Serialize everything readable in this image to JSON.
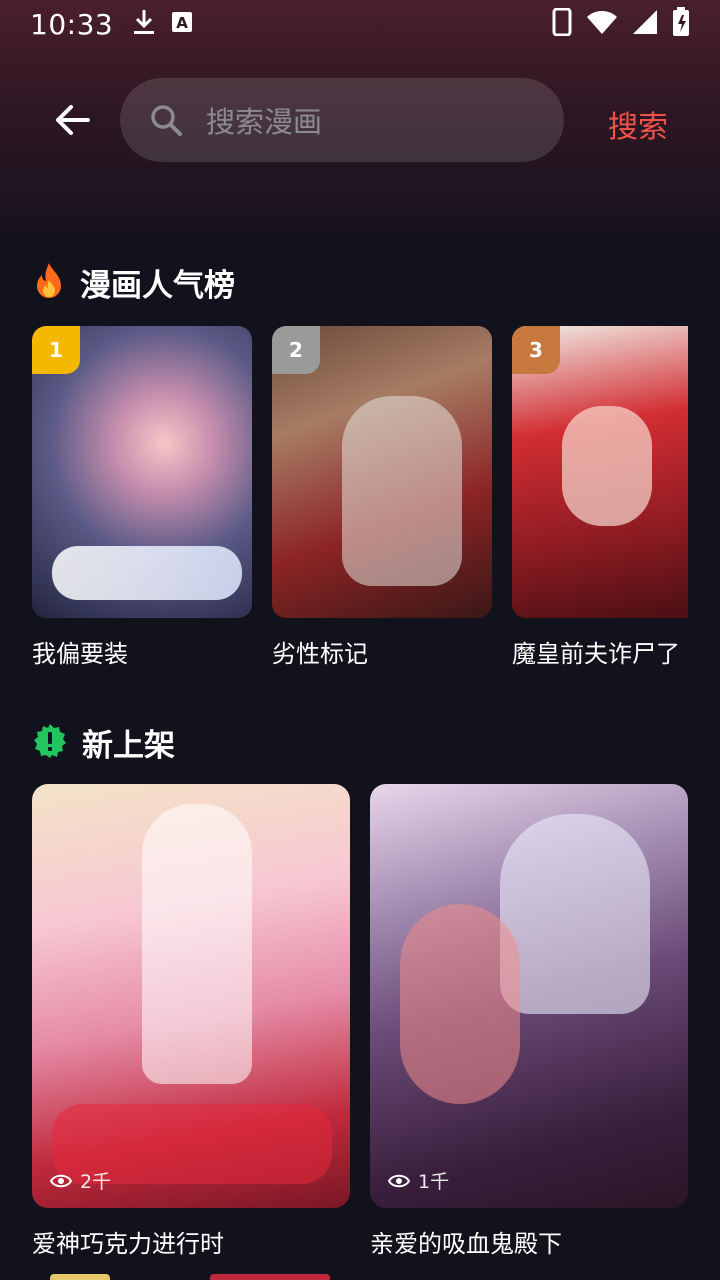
{
  "status_bar": {
    "time": "10:33"
  },
  "search": {
    "placeholder": "搜索漫画",
    "action_label": "搜索"
  },
  "sections": {
    "popular": {
      "title": "漫画人气榜",
      "items": [
        {
          "rank": "1",
          "title": "我偏要装",
          "badge_color": "#f5b800"
        },
        {
          "rank": "2",
          "title": "劣性标记",
          "badge_color": "#9a9a9a"
        },
        {
          "rank": "3",
          "title": "魔皇前夫诈尸了",
          "badge_color": "#c7783d"
        }
      ]
    },
    "new_arrivals": {
      "title": "新上架",
      "items": [
        {
          "title": "爱神巧克力进行时",
          "views": "2千"
        },
        {
          "title": "亲爱的吸血鬼殿下",
          "views": "1千"
        }
      ]
    }
  },
  "colors": {
    "accent": "#f0534b",
    "background": "#12121c",
    "new_badge": "#22c55e"
  }
}
